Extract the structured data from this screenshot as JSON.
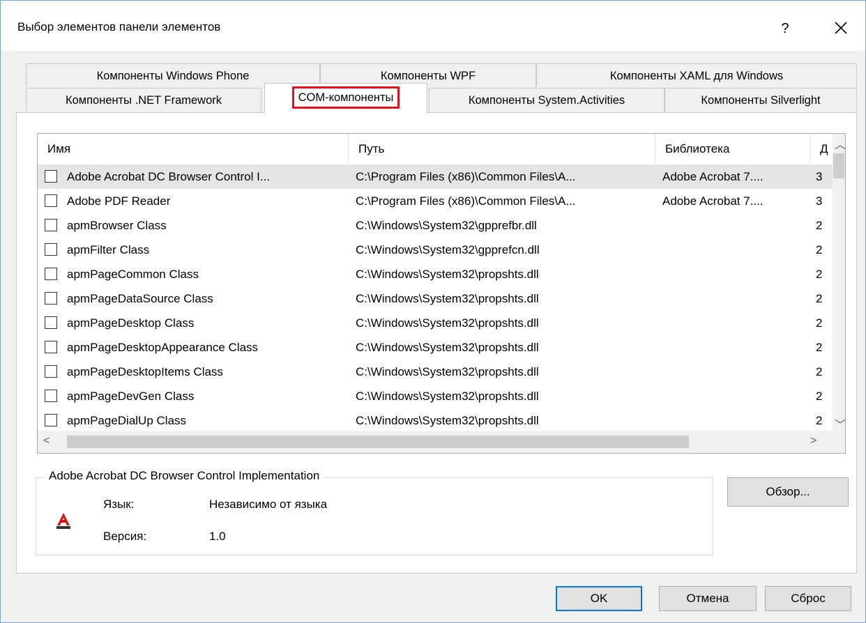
{
  "window": {
    "title": "Выбор элементов панели элементов",
    "help_label": "?"
  },
  "tabs_back": [
    {
      "label": "Компоненты Windows Phone"
    },
    {
      "label": "Компоненты WPF"
    },
    {
      "label": "Компоненты XAML для Windows"
    }
  ],
  "tabs_front": [
    {
      "label": "Компоненты .NET Framework"
    },
    {
      "label": "COM-компоненты"
    },
    {
      "label": "Компоненты System.Activities"
    },
    {
      "label": "Компоненты Silverlight"
    }
  ],
  "list": {
    "columns": [
      "Имя",
      "Путь",
      "Библиотека",
      "Д"
    ],
    "rows": [
      {
        "name": "Adobe Acrobat DC Browser Control I...",
        "path": "C:\\Program Files (x86)\\Common Files\\A...",
        "library": "Adobe Acrobat 7....",
        "extra": "3"
      },
      {
        "name": "Adobe PDF Reader",
        "path": "C:\\Program Files (x86)\\Common Files\\A...",
        "library": "Adobe Acrobat 7....",
        "extra": "3"
      },
      {
        "name": "apmBrowser Class",
        "path": "C:\\Windows\\System32\\gpprefbr.dll",
        "library": "",
        "extra": "2"
      },
      {
        "name": "apmFilter Class",
        "path": "C:\\Windows\\System32\\gpprefcn.dll",
        "library": "",
        "extra": "2"
      },
      {
        "name": "apmPageCommon Class",
        "path": "C:\\Windows\\System32\\propshts.dll",
        "library": "",
        "extra": "2"
      },
      {
        "name": "apmPageDataSource Class",
        "path": "C:\\Windows\\System32\\propshts.dll",
        "library": "",
        "extra": "2"
      },
      {
        "name": "apmPageDesktop Class",
        "path": "C:\\Windows\\System32\\propshts.dll",
        "library": "",
        "extra": "2"
      },
      {
        "name": "apmPageDesktopAppearance Class",
        "path": "C:\\Windows\\System32\\propshts.dll",
        "library": "",
        "extra": "2"
      },
      {
        "name": "apmPageDesktopItems Class",
        "path": "C:\\Windows\\System32\\propshts.dll",
        "library": "",
        "extra": "2"
      },
      {
        "name": "apmPageDevGen Class",
        "path": "C:\\Windows\\System32\\propshts.dll",
        "library": "",
        "extra": "2"
      },
      {
        "name": "apmPageDialUp Class",
        "path": "C:\\Windows\\System32\\propshts.dll",
        "library": "",
        "extra": "2"
      }
    ]
  },
  "details": {
    "title": "Adobe Acrobat DC Browser Control Implementation",
    "language_label": "Язык:",
    "language_value": "Независимо от языка",
    "version_label": "Версия:",
    "version_value": "1.0",
    "icon": "adobe-acrobat-icon"
  },
  "buttons": {
    "browse": "Обзор...",
    "ok": "OK",
    "cancel": "Отмена",
    "reset": "Сброс"
  },
  "colors": {
    "highlight": "#e3101c",
    "selected_row": "#e5e5e5",
    "default_button": "#0078d7"
  }
}
